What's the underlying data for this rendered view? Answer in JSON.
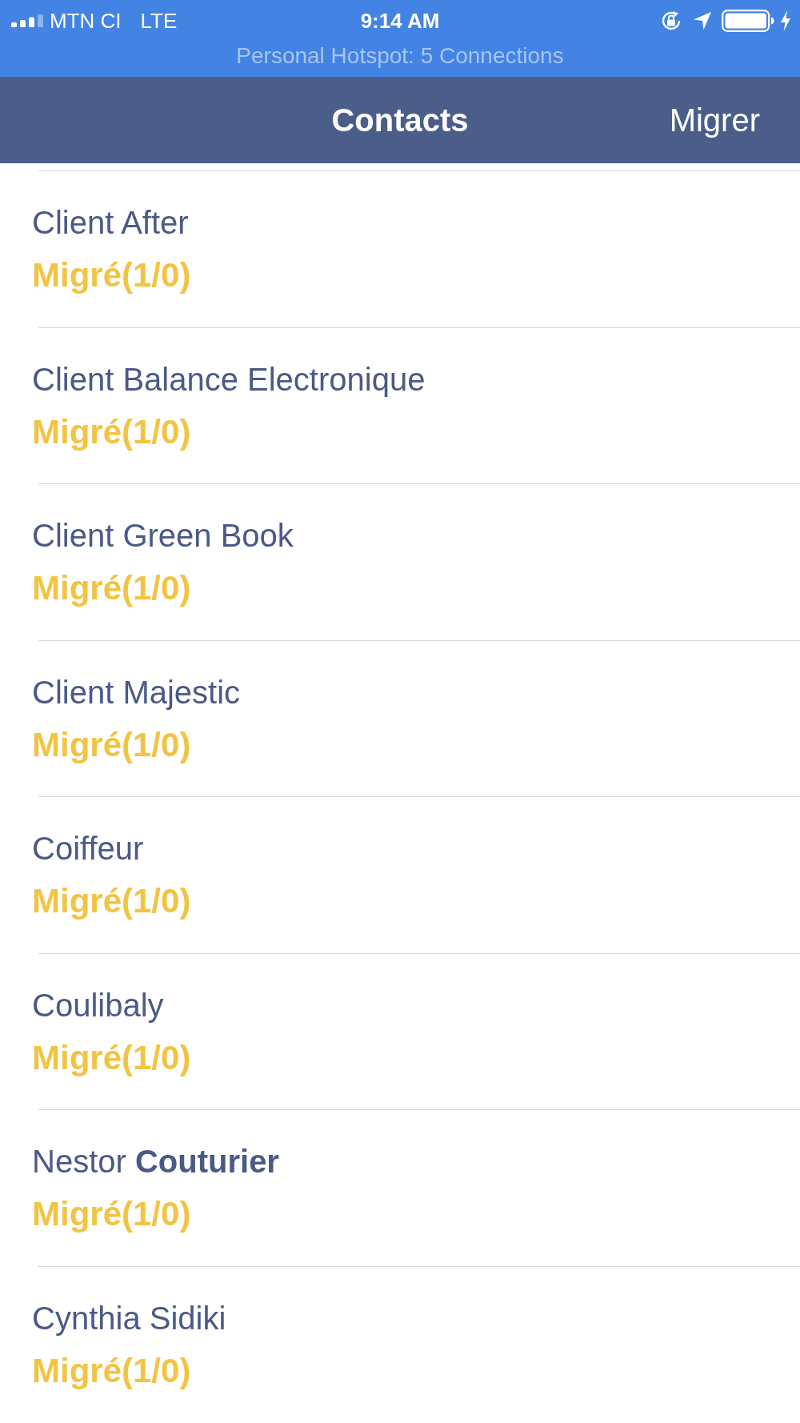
{
  "status_bar": {
    "carrier": "MTN CI",
    "network": "LTE",
    "time": "9:14 AM",
    "hotspot": "Personal Hotspot: 5 Connections"
  },
  "nav_bar": {
    "title": "Contacts",
    "action": "Migrer"
  },
  "contacts": [
    {
      "name": "Client After",
      "status": "Migré(1/0)"
    },
    {
      "name": "Client Balance Electronique",
      "status": "Migré(1/0)"
    },
    {
      "name": "Client Green Book",
      "status": "Migré(1/0)"
    },
    {
      "name": "Client Majestic",
      "status": "Migré(1/0)"
    },
    {
      "name": "Coiffeur",
      "status": "Migré(1/0)"
    },
    {
      "name": "Coulibaly",
      "status": "Migré(1/0)"
    },
    {
      "name": "Nestor **Couturier**",
      "status": "Migré(1/0)"
    },
    {
      "name": "Cynthia Sidiki",
      "status": "Migré(1/0)"
    }
  ]
}
